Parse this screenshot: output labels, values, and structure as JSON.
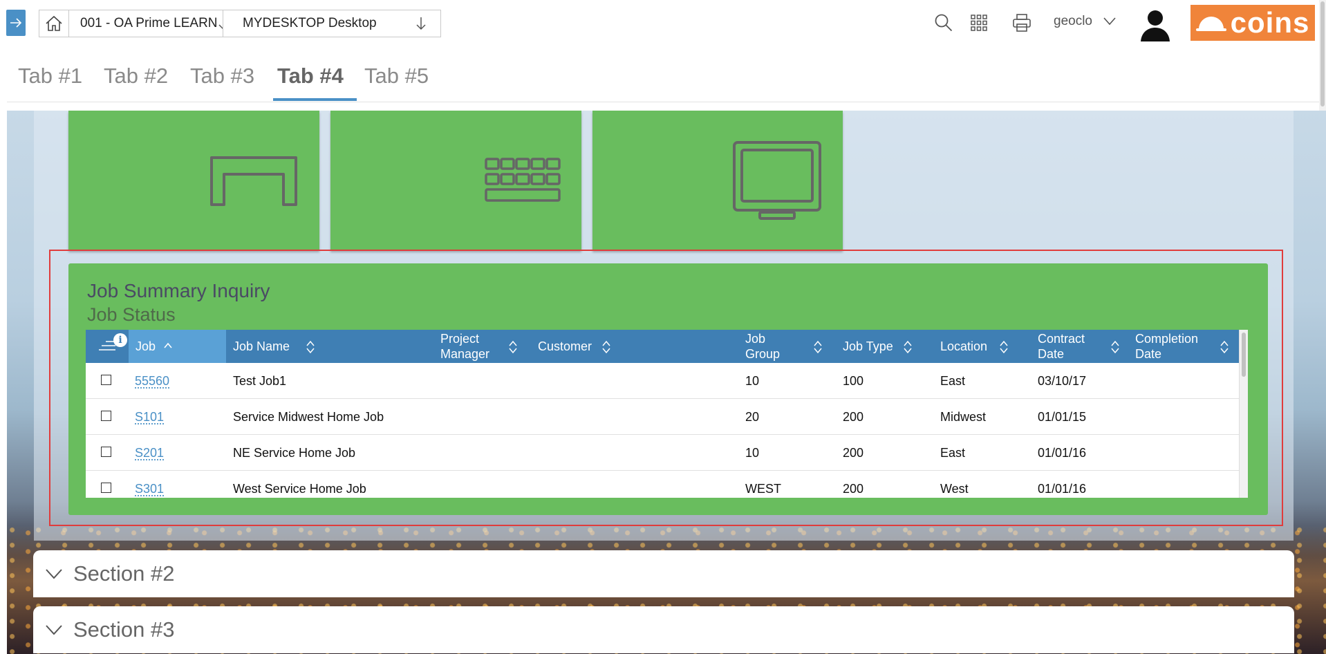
{
  "topbar": {
    "company": "001 - OA Prime LEARN",
    "desktop": "MYDESKTOP Desktop",
    "username": "geoclo",
    "logo_text": "coins",
    "colors": {
      "accent": "#4a90c6",
      "brand": "#f0843a",
      "tile_green": "#69bd5e"
    }
  },
  "tabs": [
    {
      "label": "Tab #1"
    },
    {
      "label": "Tab #2"
    },
    {
      "label": "Tab #3"
    },
    {
      "label": "Tab #4",
      "active": true
    },
    {
      "label": "Tab #5"
    }
  ],
  "tiles": [
    {
      "icon": "desk-icon"
    },
    {
      "icon": "keyboard-icon"
    },
    {
      "icon": "monitor-icon"
    }
  ],
  "widget": {
    "title": "Job Summary Inquiry",
    "subtitle": "Job Status",
    "columns": [
      {
        "label": "Job",
        "sort": "ascending"
      },
      {
        "label": "Job Name"
      },
      {
        "label": "Project\nManager"
      },
      {
        "label": "Customer"
      },
      {
        "label": "Job\nGroup"
      },
      {
        "label": "Job Type"
      },
      {
        "label": "Location"
      },
      {
        "label": "Contract\nDate"
      },
      {
        "label": "Completion\nDate"
      }
    ],
    "rows": [
      {
        "job": "55560",
        "name": "Test Job1",
        "pm": "",
        "customer": "",
        "group": "10",
        "type": "100",
        "location": "East",
        "contract": "03/10/17",
        "completion": ""
      },
      {
        "job": "S101",
        "name": "Service Midwest Home Job",
        "pm": "",
        "customer": "",
        "group": "20",
        "type": "200",
        "location": "Midwest",
        "contract": "01/01/15",
        "completion": ""
      },
      {
        "job": "S201",
        "name": "NE Service Home Job",
        "pm": "",
        "customer": "",
        "group": "10",
        "type": "200",
        "location": "East",
        "contract": "01/01/16",
        "completion": ""
      },
      {
        "job": "S301",
        "name": "West Service Home Job",
        "pm": "",
        "customer": "",
        "group": "WEST",
        "type": "200",
        "location": "West",
        "contract": "01/01/16",
        "completion": ""
      }
    ]
  },
  "sections": [
    {
      "title": "Section #2"
    },
    {
      "title": "Section #3"
    }
  ]
}
